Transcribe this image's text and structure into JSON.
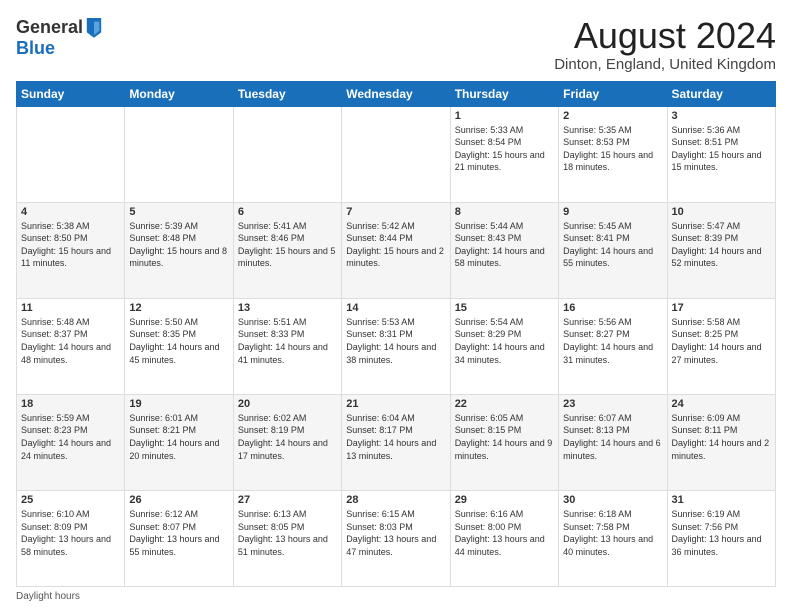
{
  "header": {
    "logo_line1": "General",
    "logo_line2": "Blue",
    "title": "August 2024",
    "subtitle": "Dinton, England, United Kingdom"
  },
  "days_of_week": [
    "Sunday",
    "Monday",
    "Tuesday",
    "Wednesday",
    "Thursday",
    "Friday",
    "Saturday"
  ],
  "weeks": [
    [
      {
        "day": "",
        "info": ""
      },
      {
        "day": "",
        "info": ""
      },
      {
        "day": "",
        "info": ""
      },
      {
        "day": "",
        "info": ""
      },
      {
        "day": "1",
        "info": "Sunrise: 5:33 AM\nSunset: 8:54 PM\nDaylight: 15 hours and 21 minutes."
      },
      {
        "day": "2",
        "info": "Sunrise: 5:35 AM\nSunset: 8:53 PM\nDaylight: 15 hours and 18 minutes."
      },
      {
        "day": "3",
        "info": "Sunrise: 5:36 AM\nSunset: 8:51 PM\nDaylight: 15 hours and 15 minutes."
      }
    ],
    [
      {
        "day": "4",
        "info": "Sunrise: 5:38 AM\nSunset: 8:50 PM\nDaylight: 15 hours and 11 minutes."
      },
      {
        "day": "5",
        "info": "Sunrise: 5:39 AM\nSunset: 8:48 PM\nDaylight: 15 hours and 8 minutes."
      },
      {
        "day": "6",
        "info": "Sunrise: 5:41 AM\nSunset: 8:46 PM\nDaylight: 15 hours and 5 minutes."
      },
      {
        "day": "7",
        "info": "Sunrise: 5:42 AM\nSunset: 8:44 PM\nDaylight: 15 hours and 2 minutes."
      },
      {
        "day": "8",
        "info": "Sunrise: 5:44 AM\nSunset: 8:43 PM\nDaylight: 14 hours and 58 minutes."
      },
      {
        "day": "9",
        "info": "Sunrise: 5:45 AM\nSunset: 8:41 PM\nDaylight: 14 hours and 55 minutes."
      },
      {
        "day": "10",
        "info": "Sunrise: 5:47 AM\nSunset: 8:39 PM\nDaylight: 14 hours and 52 minutes."
      }
    ],
    [
      {
        "day": "11",
        "info": "Sunrise: 5:48 AM\nSunset: 8:37 PM\nDaylight: 14 hours and 48 minutes."
      },
      {
        "day": "12",
        "info": "Sunrise: 5:50 AM\nSunset: 8:35 PM\nDaylight: 14 hours and 45 minutes."
      },
      {
        "day": "13",
        "info": "Sunrise: 5:51 AM\nSunset: 8:33 PM\nDaylight: 14 hours and 41 minutes."
      },
      {
        "day": "14",
        "info": "Sunrise: 5:53 AM\nSunset: 8:31 PM\nDaylight: 14 hours and 38 minutes."
      },
      {
        "day": "15",
        "info": "Sunrise: 5:54 AM\nSunset: 8:29 PM\nDaylight: 14 hours and 34 minutes."
      },
      {
        "day": "16",
        "info": "Sunrise: 5:56 AM\nSunset: 8:27 PM\nDaylight: 14 hours and 31 minutes."
      },
      {
        "day": "17",
        "info": "Sunrise: 5:58 AM\nSunset: 8:25 PM\nDaylight: 14 hours and 27 minutes."
      }
    ],
    [
      {
        "day": "18",
        "info": "Sunrise: 5:59 AM\nSunset: 8:23 PM\nDaylight: 14 hours and 24 minutes."
      },
      {
        "day": "19",
        "info": "Sunrise: 6:01 AM\nSunset: 8:21 PM\nDaylight: 14 hours and 20 minutes."
      },
      {
        "day": "20",
        "info": "Sunrise: 6:02 AM\nSunset: 8:19 PM\nDaylight: 14 hours and 17 minutes."
      },
      {
        "day": "21",
        "info": "Sunrise: 6:04 AM\nSunset: 8:17 PM\nDaylight: 14 hours and 13 minutes."
      },
      {
        "day": "22",
        "info": "Sunrise: 6:05 AM\nSunset: 8:15 PM\nDaylight: 14 hours and 9 minutes."
      },
      {
        "day": "23",
        "info": "Sunrise: 6:07 AM\nSunset: 8:13 PM\nDaylight: 14 hours and 6 minutes."
      },
      {
        "day": "24",
        "info": "Sunrise: 6:09 AM\nSunset: 8:11 PM\nDaylight: 14 hours and 2 minutes."
      }
    ],
    [
      {
        "day": "25",
        "info": "Sunrise: 6:10 AM\nSunset: 8:09 PM\nDaylight: 13 hours and 58 minutes."
      },
      {
        "day": "26",
        "info": "Sunrise: 6:12 AM\nSunset: 8:07 PM\nDaylight: 13 hours and 55 minutes."
      },
      {
        "day": "27",
        "info": "Sunrise: 6:13 AM\nSunset: 8:05 PM\nDaylight: 13 hours and 51 minutes."
      },
      {
        "day": "28",
        "info": "Sunrise: 6:15 AM\nSunset: 8:03 PM\nDaylight: 13 hours and 47 minutes."
      },
      {
        "day": "29",
        "info": "Sunrise: 6:16 AM\nSunset: 8:00 PM\nDaylight: 13 hours and 44 minutes."
      },
      {
        "day": "30",
        "info": "Sunrise: 6:18 AM\nSunset: 7:58 PM\nDaylight: 13 hours and 40 minutes."
      },
      {
        "day": "31",
        "info": "Sunrise: 6:19 AM\nSunset: 7:56 PM\nDaylight: 13 hours and 36 minutes."
      }
    ]
  ],
  "footer": {
    "note": "Daylight hours"
  }
}
